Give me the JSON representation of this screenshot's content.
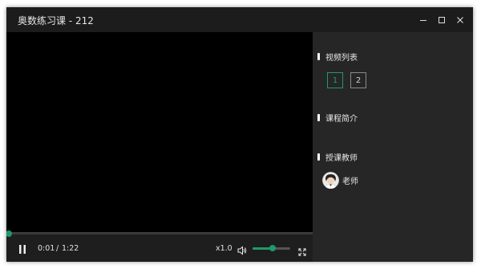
{
  "window": {
    "title": "奥数练习课 - 212",
    "controls": [
      "minimize-icon",
      "maximize-icon",
      "close-icon"
    ]
  },
  "player": {
    "progress_fraction": 0.0,
    "current_time": "0:01",
    "time_separator": "/",
    "duration": "1:22",
    "play_state_icon": "pause-icon",
    "speed": "x1.0",
    "volume_fraction": 0.53,
    "volume_icon": "volume-icon",
    "fullscreen_icon": "fullscreen-icon"
  },
  "sidebar": {
    "video_list_title": "视频列表",
    "episodes": [
      {
        "label": "1",
        "active": true
      },
      {
        "label": "2",
        "active": false
      }
    ],
    "intro_title": "课程简介",
    "teacher_section_title": "授课教师",
    "teacher_name": "老师"
  },
  "colors": {
    "accent": "#1f9a6a",
    "window_bg": "#262626",
    "titlebar_bg": "#1c1c1c",
    "video_bg": "#000000",
    "controls_bg": "#1e1e1e"
  }
}
